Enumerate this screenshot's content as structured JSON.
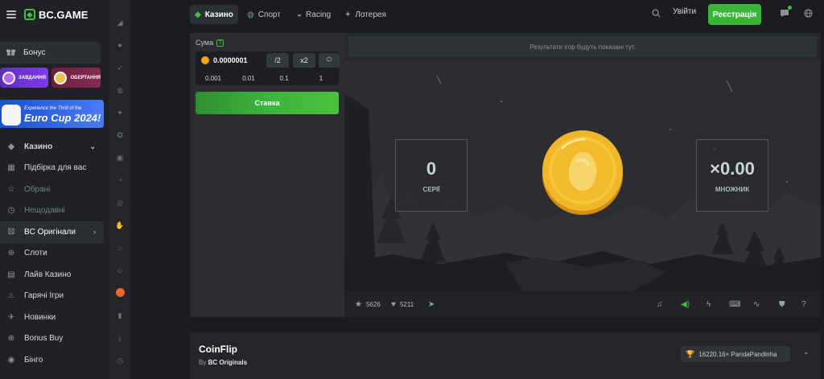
{
  "brand": {
    "name": "BC.GAME"
  },
  "sidebar": {
    "bonus_label": "Бонус",
    "mini_cards": [
      "ЗАВДАННЯ",
      "ОБЕРТАННЯ"
    ],
    "banner": {
      "small": "Experience the Thrill of the",
      "big": "Euro Cup 2024!"
    },
    "items": [
      {
        "label": "Казино",
        "icon": "casino-icon",
        "chevron": "⌄",
        "bold": true
      },
      {
        "label": "Підбірка для вас",
        "icon": "grid-icon"
      },
      {
        "label": "Обрані",
        "icon": "star-icon",
        "dim": true
      },
      {
        "label": "Нещодавні",
        "icon": "clock-icon",
        "dim": true
      },
      {
        "label": "BC Оригінали",
        "icon": "dice-icon",
        "chevron": "›",
        "active": true
      },
      {
        "label": "Слоти",
        "icon": "slots-icon"
      },
      {
        "label": "Лайв Казино",
        "icon": "live-icon"
      },
      {
        "label": "Гарячі Ігри",
        "icon": "fire-icon"
      },
      {
        "label": "Новинки",
        "icon": "new-icon"
      },
      {
        "label": "Bonus Buy",
        "icon": "bonus-buy-icon"
      },
      {
        "label": "Бінго",
        "icon": "bingo-icon"
      }
    ]
  },
  "topbar": {
    "tabs": [
      {
        "label": "Казино",
        "icon": "casino-icon",
        "active": true
      },
      {
        "label": "Спорт",
        "icon": "sport-icon"
      },
      {
        "label": "Racing",
        "icon": "racing-icon"
      },
      {
        "label": "Лотерея",
        "icon": "lottery-icon"
      }
    ],
    "login_label": "Увійти",
    "signup_label": "Реєстрація"
  },
  "bet": {
    "amount_label": "Сума",
    "amount_value": "0.0000001",
    "half_label": "/2",
    "double_label": "x2",
    "presets": [
      "0.001",
      "0.01",
      "0.1",
      "1"
    ],
    "bet_button": "Ставка"
  },
  "game": {
    "results_placeholder": "Результати ігор будуть показані тут.",
    "series": {
      "value": "0",
      "label": "СЕРІЇ"
    },
    "multiplier": {
      "value": "×0.00",
      "label": "МНОЖНИК"
    },
    "likes_count": "5626",
    "favorites_count": "5211"
  },
  "info": {
    "title": "CoinFlip",
    "by_prefix": "By",
    "by_name": "BC Originals",
    "record": "16220.16× PandaPandinha"
  },
  "colors": {
    "accent": "#3cc13b",
    "coin": "#f2b62a"
  }
}
